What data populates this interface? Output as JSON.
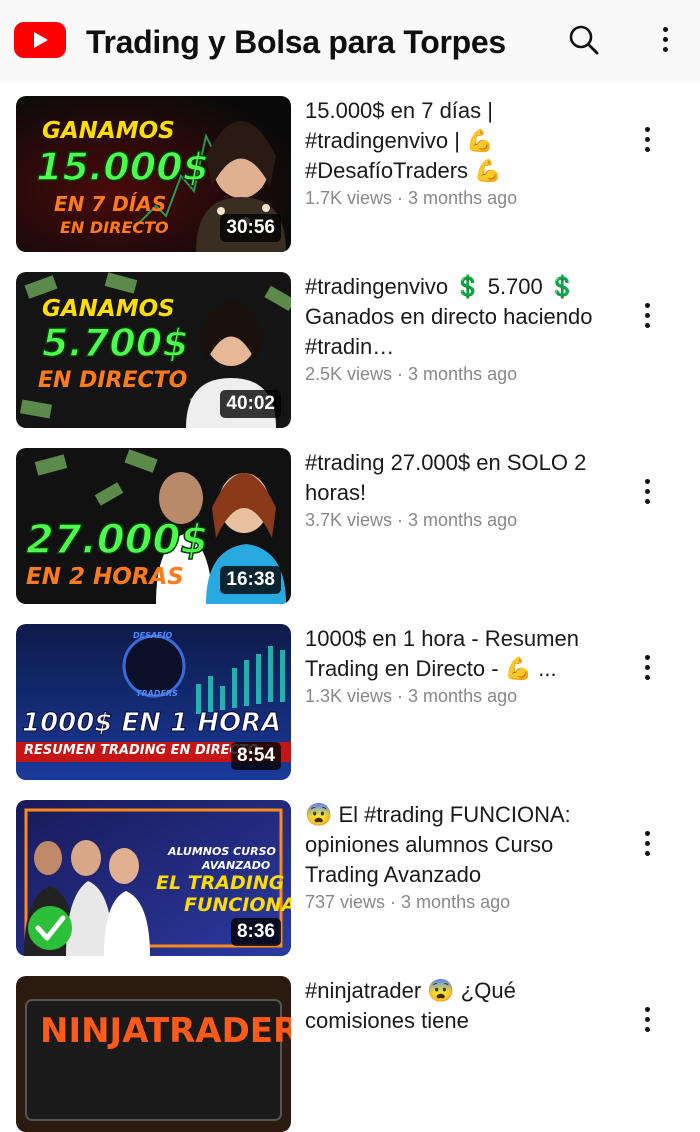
{
  "header": {
    "channel_title": "Trading y Bolsa para Torpes",
    "logo_icon": "youtube-logo-icon",
    "search_icon": "search-icon",
    "more_icon": "more-vertical-icon"
  },
  "videos": [
    {
      "title": "15.000$ en 7 días | #tradingenvivo | 💪 #DesafíoTraders 💪",
      "stats": "1.7K views · 3 months ago",
      "duration": "30:56",
      "thumb_lines": [
        "GANAMOS",
        "15.000$",
        "EN 7 DÍAS",
        "EN DIRECTO"
      ]
    },
    {
      "title": "#tradingenvivo 💲 5.700 💲 Ganados en directo haciendo #tradin…",
      "stats": "2.5K views · 3 months ago",
      "duration": "40:02",
      "thumb_lines": [
        "GANAMOS",
        "5.700$",
        "EN DIRECTO"
      ]
    },
    {
      "title": "#trading 27.000$ en SOLO 2 horas!",
      "stats": "3.7K views · 3 months ago",
      "duration": "16:38",
      "thumb_lines": [
        "27.000$",
        "EN 2 HORAS"
      ]
    },
    {
      "title": "1000$ en 1 hora - Resumen Trading en Directo - 💪 ...",
      "stats": "1.3K views · 3 months ago",
      "duration": "8:54",
      "thumb_lines": [
        "DESAFÍO",
        "TRADERS",
        "1000$ EN 1 HORA",
        "RESUMEN TRADING EN DIRECTO"
      ]
    },
    {
      "title": "😨 El #trading FUNCIONA: opiniones alumnos Curso Trading Avanzado",
      "stats": "737 views · 3 months ago",
      "duration": "8:36",
      "thumb_lines": [
        "ALUMNOS CURSO",
        "AVANZADO",
        "EL TRADING",
        "FUNCIONA"
      ]
    },
    {
      "title": "#ninjatrader 😨 ¿Qué comisiones tiene",
      "stats": "",
      "duration": "",
      "thumb_lines": [
        "NINJATRADER"
      ]
    }
  ]
}
